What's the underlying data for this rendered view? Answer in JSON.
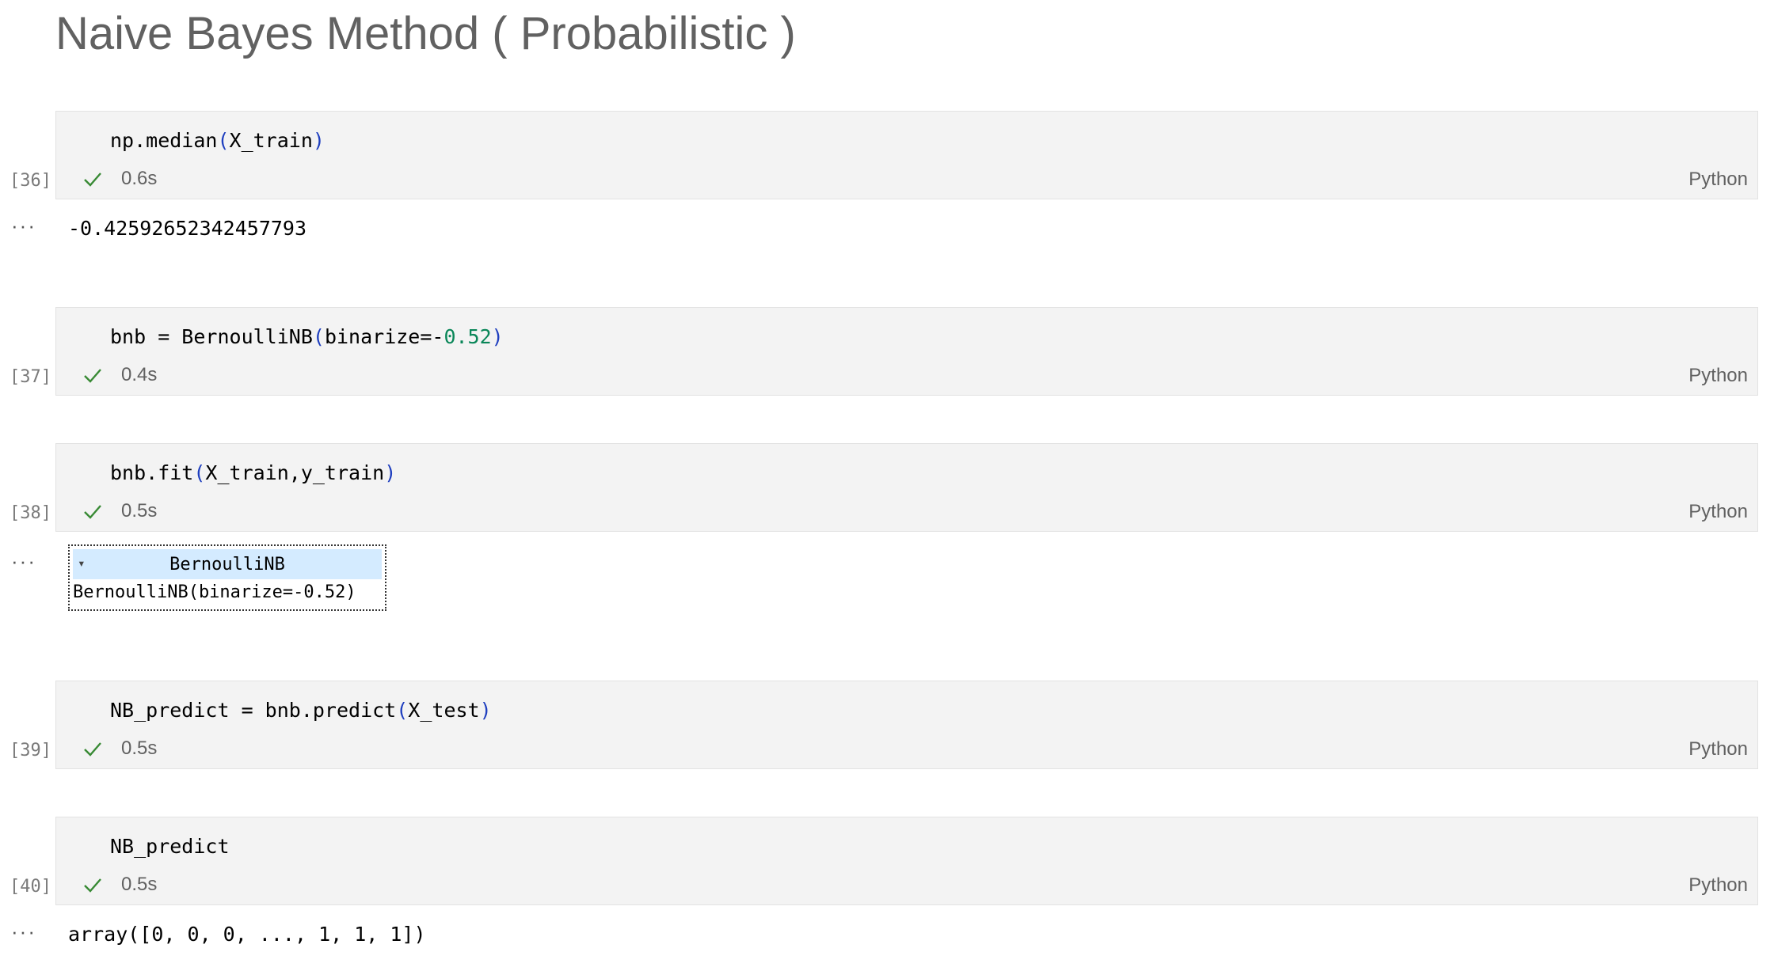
{
  "heading": "Naive Bayes Method ( Probabilistic )",
  "cells": [
    {
      "count": "[36]",
      "code_parts": [
        "np.median",
        "(",
        "X_train",
        ")"
      ],
      "time": "0.6s",
      "language": "Python",
      "output": "-0.42592652342457793"
    },
    {
      "count": "[37]",
      "code_parts": [
        "bnb = BernoulliNB",
        "(",
        "binarize=-",
        "0.52",
        ")"
      ],
      "time": "0.4s",
      "language": "Python"
    },
    {
      "count": "[38]",
      "code_parts": [
        "bnb.fit",
        "(",
        "X_train,y_train",
        ")"
      ],
      "time": "0.5s",
      "language": "Python",
      "estimator": {
        "arrow": "▾",
        "title": "BernoulliNB",
        "repr": "BernoulliNB(binarize=-0.52)"
      }
    },
    {
      "count": "[39]",
      "code_parts": [
        "NB_predict = bnb.predict",
        "(",
        "X_test",
        ")"
      ],
      "time": "0.5s",
      "language": "Python"
    },
    {
      "count": "[40]",
      "code_parts": [
        "NB_predict"
      ],
      "time": "0.5s",
      "language": "Python",
      "output": "array([0, 0, 0, ..., 1, 1, 1])"
    }
  ],
  "output_marker": "···",
  "colors": {
    "check": "#388a34",
    "paren": "#1f3fbf",
    "number": "#098658",
    "estimator_header": "#d4ebff"
  }
}
